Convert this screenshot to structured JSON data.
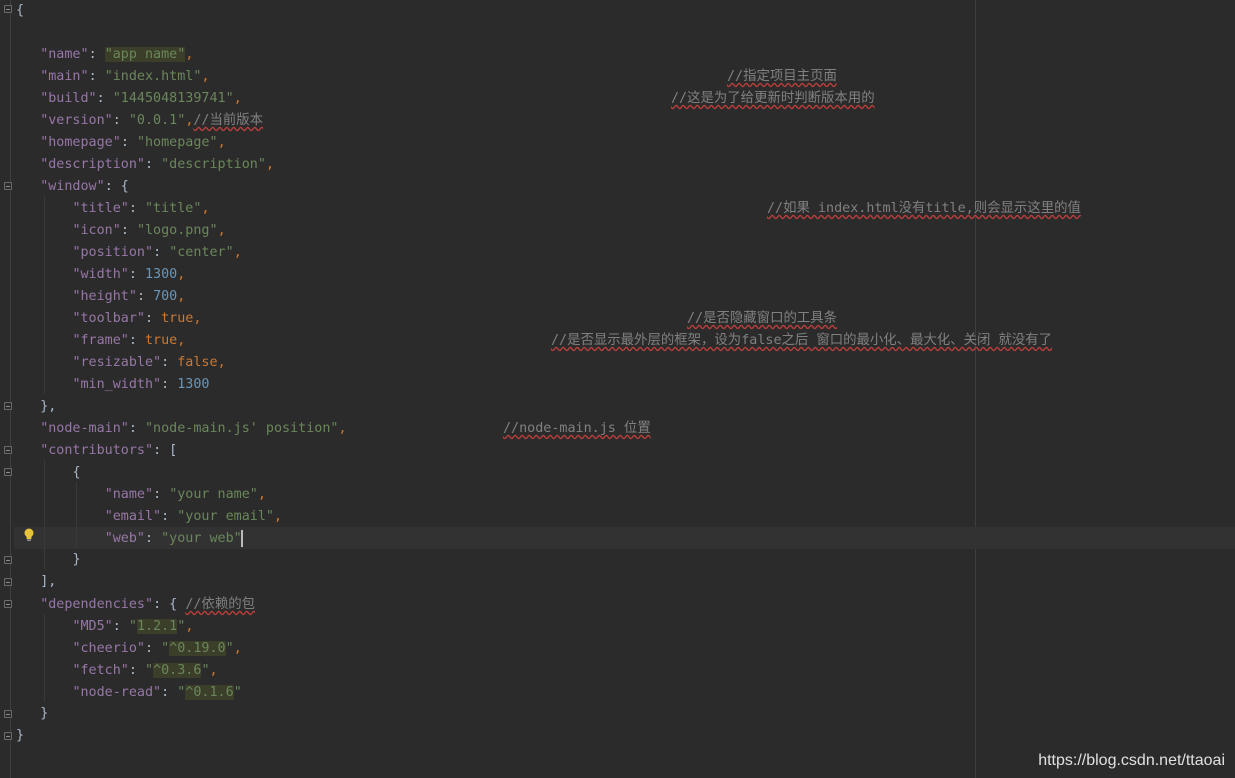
{
  "editor": {
    "lines": {
      "l1": [
        "{"
      ],
      "l3": [
        "\"name\"",
        ": ",
        "\"app name\"",
        ","
      ],
      "l4": [
        "\"main\"",
        ": ",
        "\"index.html\"",
        ","
      ],
      "l5": [
        "\"build\"",
        ": ",
        "\"1445048139741\"",
        ","
      ],
      "l6": [
        "\"version\"",
        ": ",
        "\"0.0.1\"",
        ",",
        "//当前版本"
      ],
      "l7": [
        "\"homepage\"",
        ": ",
        "\"homepage\"",
        ","
      ],
      "l8": [
        "\"description\"",
        ": ",
        "\"description\"",
        ","
      ],
      "l9": [
        "\"window\"",
        ": {"
      ],
      "l10": [
        "\"title\"",
        ": ",
        "\"title\"",
        ","
      ],
      "l11": [
        "\"icon\"",
        ": ",
        "\"logo.png\"",
        ","
      ],
      "l12": [
        "\"position\"",
        ": ",
        "\"center\"",
        ","
      ],
      "l13": [
        "\"width\"",
        ": ",
        "1300",
        ","
      ],
      "l14": [
        "\"height\"",
        ": ",
        "700",
        ","
      ],
      "l15": [
        "\"toolbar\"",
        ": ",
        "true",
        ","
      ],
      "l16": [
        "\"frame\"",
        ": ",
        "true",
        ","
      ],
      "l17": [
        "\"resizable\"",
        ": ",
        "false",
        ","
      ],
      "l18": [
        "\"min_width\"",
        ": ",
        "1300"
      ],
      "l19": [
        "},"
      ],
      "l20": [
        "\"node-main\"",
        ": ",
        "\"node-main.js' position\"",
        ","
      ],
      "l21": [
        "\"contributors\"",
        ": ["
      ],
      "l22": [
        "{"
      ],
      "l23": [
        "\"name\"",
        ": ",
        "\"your name\"",
        ","
      ],
      "l24": [
        "\"email\"",
        ": ",
        "\"your email\"",
        ","
      ],
      "l25": [
        "\"web\"",
        ": ",
        "\"your web\""
      ],
      "l26": [
        "}"
      ],
      "l27": [
        "],"
      ],
      "l28": [
        "\"dependencies\"",
        ": { ",
        "//依赖的包"
      ],
      "l29": [
        "\"MD5\"",
        ": ",
        "\"",
        "1.2.1",
        "\"",
        ","
      ],
      "l30": [
        "\"cheerio\"",
        ": ",
        "\"",
        "^0.19.0",
        "\"",
        ","
      ],
      "l31": [
        "\"fetch\"",
        ": ",
        "\"",
        "^0.3.6",
        "\"",
        ","
      ],
      "l32": [
        "\"node-read\"",
        ": ",
        "\"",
        "^0.1.6",
        "\""
      ],
      "l33": [
        "}"
      ],
      "l34": [
        "}"
      ]
    },
    "comments": {
      "main": "//指定项目主页面",
      "build": "//这是为了给更新时判断版本用的",
      "title": "//如果 index.html没有title,则会显示这里的值",
      "toolbar": "//是否隐藏窗口的工具条",
      "frame": "//是否显示最外层的框架，设为false之后 窗口的最小化、最大化、关闭 就没有了",
      "node_main": "//node-main.js 位置"
    }
  },
  "watermark": "https://blog.csdn.net/ttaoai",
  "colors": {
    "background": "#2b2b2b",
    "key": "#9876aa",
    "string": "#6a8759",
    "number": "#6897bb",
    "keyword": "#cc7832",
    "comment": "#808080",
    "bulb": "#e8c33c"
  },
  "icons": [
    "fold-marker-icon",
    "lightbulb-icon",
    "text-caret"
  ]
}
